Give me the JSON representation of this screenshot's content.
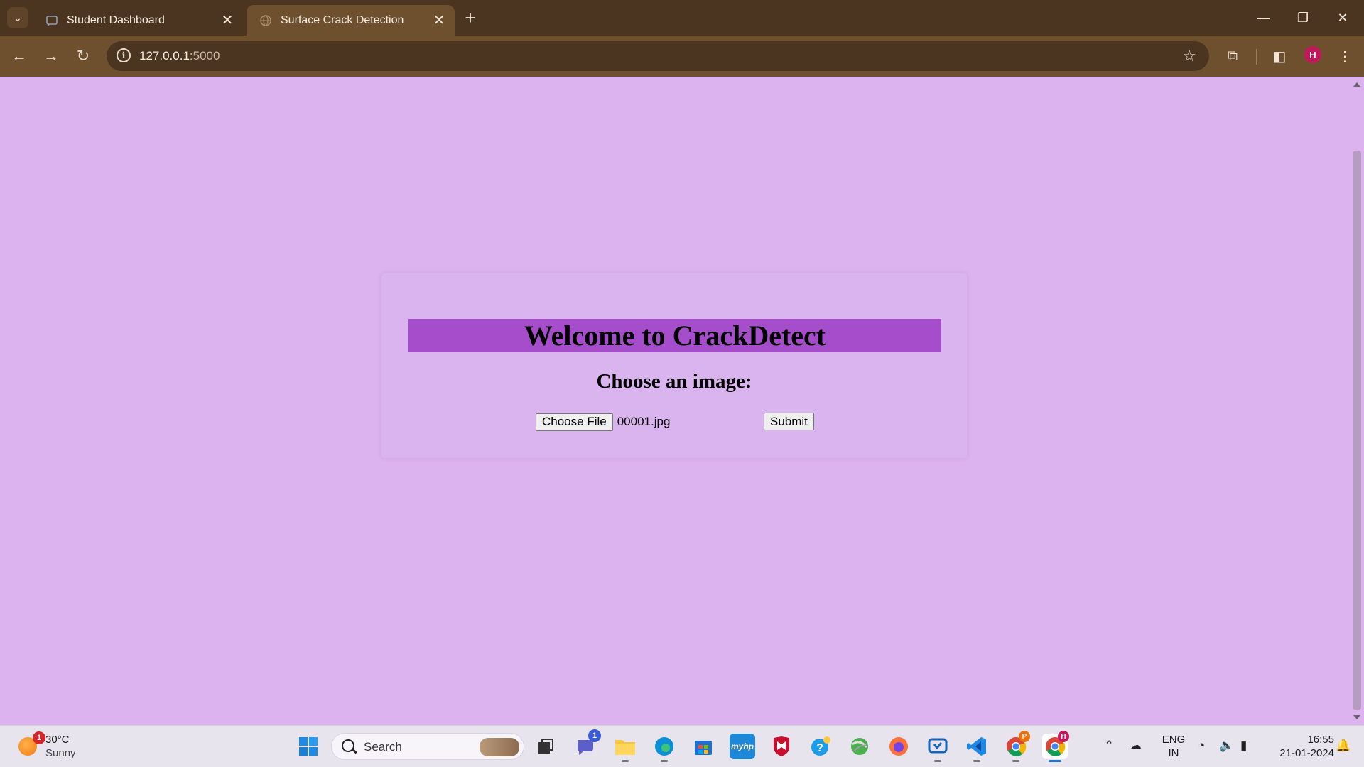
{
  "browser": {
    "tabs": [
      {
        "title": "Student Dashboard",
        "active": false
      },
      {
        "title": "Surface Crack Detection",
        "active": true
      }
    ],
    "url_host": "127.0.0.1",
    "url_port": ":5000",
    "profile_initial": "H"
  },
  "page": {
    "heading": "Welcome to CrackDetect",
    "subheading": "Choose an image:",
    "choose_file_label": "Choose File",
    "selected_file": "00001.jpg",
    "submit_label": "Submit",
    "colors": {
      "background": "#dcb2ef",
      "heading_bar": "#a64dcb"
    }
  },
  "taskbar": {
    "weather_badge": "1",
    "temperature": "30°C",
    "condition": "Sunny",
    "search_label": "Search",
    "teams_badge": "1",
    "language_line1": "ENG",
    "language_line2": "IN",
    "time": "16:55",
    "date": "21-01-2024",
    "chrome_profile_p": "P",
    "chrome_profile_h": "H"
  }
}
